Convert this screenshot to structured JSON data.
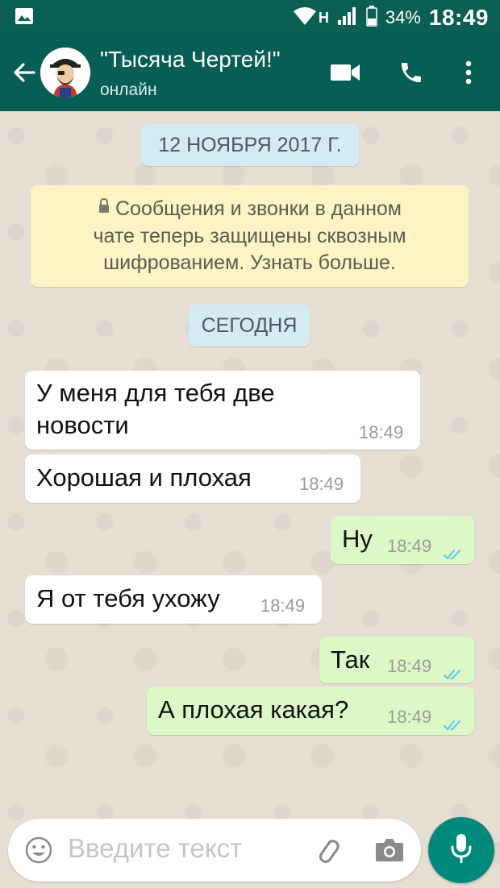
{
  "status_bar": {
    "network": "H",
    "battery": "34%",
    "time": "18:49"
  },
  "header": {
    "title": "\"Тысяча Чертей!\"",
    "subtitle": "онлайн"
  },
  "chat": {
    "date_chip": "12 НОЯБРЯ 2017 Г.",
    "encryption_notice": {
      "line1": "Сообщения и звонки в данном",
      "line2": "чате теперь защищены сквозным",
      "line3": "шифрованием. Узнать больше."
    },
    "today_chip": "СЕГОДНЯ",
    "messages": [
      {
        "direction": "incoming",
        "lines": [
          "У меня для тебя две",
          "новости"
        ],
        "time": "18:49"
      },
      {
        "direction": "incoming",
        "text": "Хорошая и плохая",
        "time": "18:49"
      },
      {
        "direction": "outgoing",
        "text": "Ну",
        "time": "18:49",
        "status": "read"
      },
      {
        "direction": "incoming",
        "text": "Я от тебя ухожу",
        "time": "18:49"
      },
      {
        "direction": "outgoing",
        "text": "Так",
        "time": "18:49",
        "status": "read"
      },
      {
        "direction": "outgoing",
        "text": "А плохая какая?",
        "time": "18:49",
        "status": "read"
      }
    ]
  },
  "composer": {
    "placeholder": "Введите текст"
  },
  "colors": {
    "header": "#075e54",
    "status_bar": "#0a5f52",
    "chat_background": "#e6ded3",
    "incoming_bubble": "#ffffff",
    "outgoing_bubble": "#dcf8c6",
    "read_ticks": "#4fc3f7",
    "mic_button": "#00897b"
  },
  "icons": [
    "image-icon",
    "wifi-icon",
    "signal-icon",
    "battery-icon",
    "back-arrow-icon",
    "video-call-icon",
    "phone-icon",
    "more-vert-icon",
    "lock-icon",
    "double-check-icon",
    "emoji-icon",
    "attach-icon",
    "camera-icon",
    "mic-icon"
  ]
}
